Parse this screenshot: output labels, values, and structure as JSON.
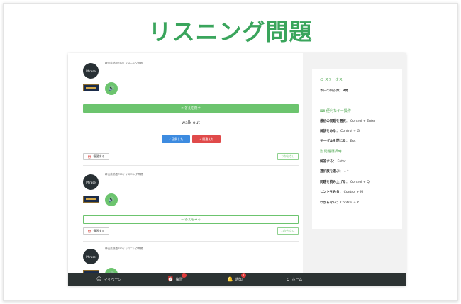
{
  "hero": {
    "title": "リスニング問題"
  },
  "cards": [
    {
      "source": "瞬出英熟語750 / リスニング問題",
      "avatar_label": "Phrase",
      "toggle_label": "✕ 答えを隠す",
      "answer": "walk out",
      "correct_label": "✓ 正解した",
      "wrong_label": "✓ 間違えた",
      "review_label": "復習する",
      "unknown_label": "わからない"
    },
    {
      "source": "瞬出英熟語750 / リスニング問題",
      "avatar_label": "Phrase",
      "toggle_label": "☰ 答えをみる",
      "review_label": "復習する",
      "unknown_label": "わからない"
    },
    {
      "source": "瞬出英熟語750 / リスニング問題",
      "avatar_label": "Phrase"
    }
  ],
  "sidebar": {
    "status_heading": "ステータス",
    "answers_today_label": "本日の解答数：",
    "answers_today_value": "3問",
    "keys_heading": "便利なキー操作",
    "keys": [
      {
        "label": "最初の問題を選択：",
        "value": "Control + Enter"
      },
      {
        "label": "解説をみる：",
        "value": "Control + G"
      },
      {
        "label": "モーダルを閉じる：",
        "value": "Esc"
      }
    ],
    "select_heading": "問題選択時",
    "select_keys": [
      {
        "label": "解答する：",
        "value": "Enter"
      },
      {
        "label": "選択肢を選ぶ：",
        "value": "↓↑"
      },
      {
        "label": "問題を読み上げる：",
        "value": "Control + Q"
      },
      {
        "label": "ヒントをみる：",
        "value": "Control + M"
      },
      {
        "label": "わからない：",
        "value": "Control + Y"
      }
    ]
  },
  "nav": {
    "mypage": "マイページ",
    "review": "復習",
    "review_badge": "1",
    "notify": "通知",
    "notify_badge": "1",
    "home": "ホーム"
  },
  "colors": {
    "accent": "#3aa55c",
    "button_green": "#6cc46e",
    "correct": "#3d8be0",
    "wrong": "#e04a4a",
    "nav_bg": "#2c3333"
  }
}
